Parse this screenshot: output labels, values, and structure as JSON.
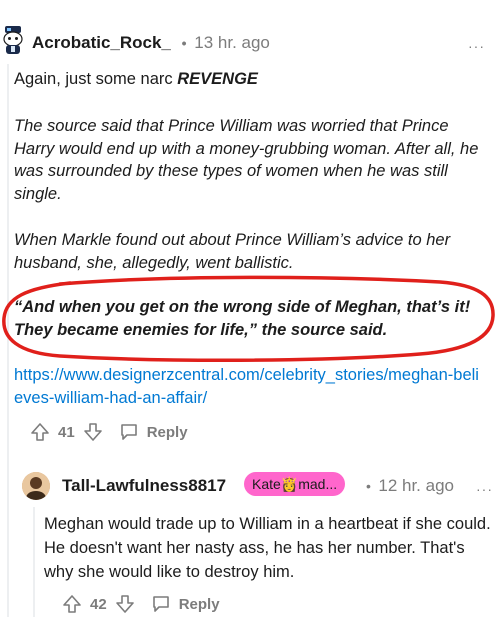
{
  "comment1": {
    "username": "Acrobatic_Rock_",
    "separator": "•",
    "time": "13 hr. ago",
    "more": "···",
    "para1_prefix": "Again, just some narc ",
    "para1_emph": "REVENGE",
    "para2": "The source said that Prince William was worried that Prince Harry would end up with a money-grubbing woman. After all, he was surrounded by these types of women when he was still single.",
    "para3": "When Markle found out about Prince William’s advice to her husband, she, allegedly, went ballistic.",
    "quote": "“And when you get on the wrong side of Meghan, that’s it! They became enemies for life,” the source said.",
    "link": "https://www.designerzcentral.com/celebrity_stories/meghan-believes-william-had-an-affair/",
    "votes": "41",
    "reply_label": "Reply"
  },
  "comment2": {
    "username": "Tall-Lawfulness8817",
    "flair": "Kate👸mad...",
    "separator": "•",
    "time": "12 hr. ago",
    "more": "···",
    "body": "Meghan would trade up to William in a heartbeat if she could. He doesn't want her nasty ass, he has her number. That's why she would like to destroy him.",
    "votes": "42",
    "reply_label": "Reply"
  },
  "colors": {
    "annotation_circle": "#e0201b",
    "link": "#0079d3",
    "flair_bg": "#ff66cc",
    "muted": "#7c7c7c"
  }
}
